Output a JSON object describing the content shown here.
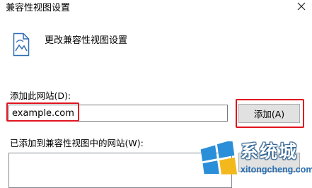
{
  "window": {
    "title": "兼容性视图设置"
  },
  "header": {
    "icon": "document-settings-icon",
    "title": "更改兼容性视图设置"
  },
  "add_site": {
    "label": "添加此网站(D):",
    "value": "example.com",
    "button_label": "添加(A)"
  },
  "added_sites": {
    "label": "已添加到兼容性视图中的网站(W):",
    "items": []
  },
  "watermark": {
    "text": "系统城",
    "url": "xitongcheng.com"
  },
  "colors": {
    "highlight": "#e0141e",
    "button_bg": "#e1e1e1",
    "watermark_blue": "#2a6fb3"
  }
}
